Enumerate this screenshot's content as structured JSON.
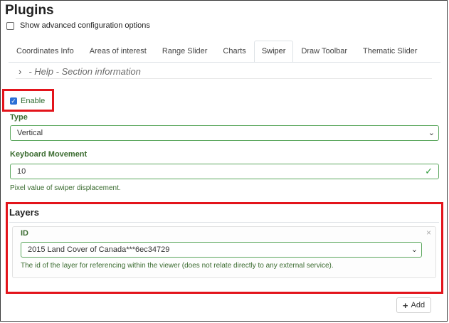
{
  "page": {
    "title": "Plugins"
  },
  "advanced": {
    "label": "Show advanced configuration options",
    "checked": false
  },
  "tabs": [
    {
      "label": "Coordinates Info",
      "active": false
    },
    {
      "label": "Areas of interest",
      "active": false
    },
    {
      "label": "Range Slider",
      "active": false
    },
    {
      "label": "Charts",
      "active": false
    },
    {
      "label": "Swiper",
      "active": true
    },
    {
      "label": "Draw Toolbar",
      "active": false
    },
    {
      "label": "Thematic Slider",
      "active": false
    }
  ],
  "help": {
    "label": "- Help - Section information",
    "icon": "chevron-right-icon"
  },
  "enable": {
    "label": "Enable",
    "checked": true
  },
  "type": {
    "label": "Type",
    "value": "Vertical"
  },
  "keyboard": {
    "label": "Keyboard Movement",
    "value": "10",
    "helper": "Pixel value of swiper displacement."
  },
  "layers": {
    "title": "Layers",
    "id_label": "ID",
    "id_value": "2015 Land Cover of Canada***6ec34729",
    "id_helper": "The id of the layer for referencing within the viewer (does not relate directly to any external service).",
    "close_symbol": "×"
  },
  "add_button": {
    "label": "Add"
  },
  "colors": {
    "highlight": "#e3141b",
    "valid": "#5da85f",
    "label_green": "#3a6b2f"
  }
}
